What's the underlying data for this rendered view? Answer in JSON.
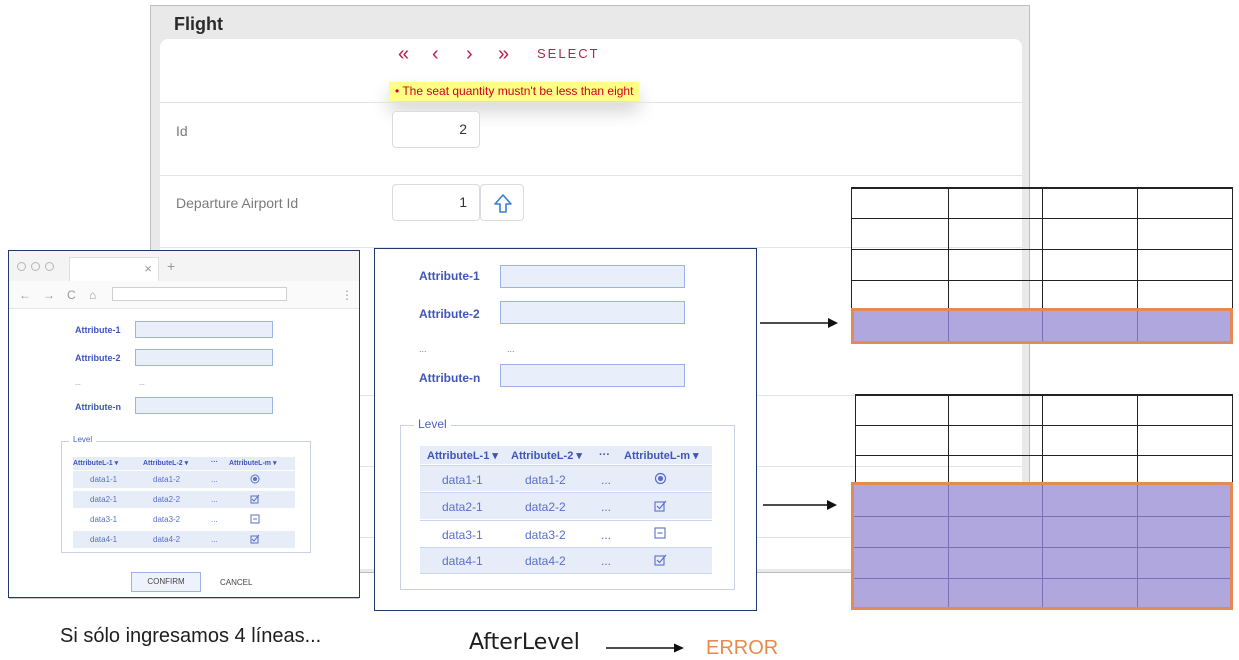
{
  "flight_form": {
    "title": "Flight",
    "nav": {
      "first": "«",
      "prev": "‹",
      "next": "›",
      "last": "»",
      "select": "SELECT"
    },
    "error": "The seat quantity mustn't be less than eight",
    "fields": [
      {
        "label": "Id",
        "value": "2"
      },
      {
        "label": "Departure Airport Id",
        "value": "1"
      }
    ]
  },
  "browser": {
    "tab_close": "×",
    "new_tab": "+",
    "nav_icons": [
      "←",
      "→",
      "C",
      "⌂"
    ],
    "menu": "⋮"
  },
  "form": {
    "attributes": [
      "Attribute-1",
      "Attribute-2",
      "...",
      "Attribute-n"
    ],
    "ellipsis_value": "...",
    "level_legend": "Level",
    "columns": [
      "AttributeL-1 ▾",
      "AttributeL-2 ▾",
      "···",
      "AttributeL-m ▾"
    ],
    "rows": [
      {
        "c1": "data1-1",
        "c2": "data1-2",
        "c3": "...",
        "icon": "radio-icon"
      },
      {
        "c1": "data2-1",
        "c2": "data2-2",
        "c3": "...",
        "icon": "checkbox-checked-icon"
      },
      {
        "c1": "data3-1",
        "c2": "data3-2",
        "c3": "...",
        "icon": "checkbox-partial-icon"
      },
      {
        "c1": "data4-1",
        "c2": "data4-2",
        "c3": "...",
        "icon": "checkbox-checked-icon"
      }
    ],
    "confirm": "CONFIRM",
    "cancel": "CANCEL"
  },
  "captions": {
    "left": "Si sólo ingresamos 4 líneas...",
    "middle": "AfterLevel",
    "right": "ERROR"
  },
  "colors": {
    "accent": "#b5224a",
    "error_text": "#d0021b",
    "error_bg": "#ffff88",
    "form_blue": "#3f56b8",
    "highlight_fill": "#afa7de",
    "highlight_border": "#e58a54",
    "error_caption": "#e88a4c"
  }
}
